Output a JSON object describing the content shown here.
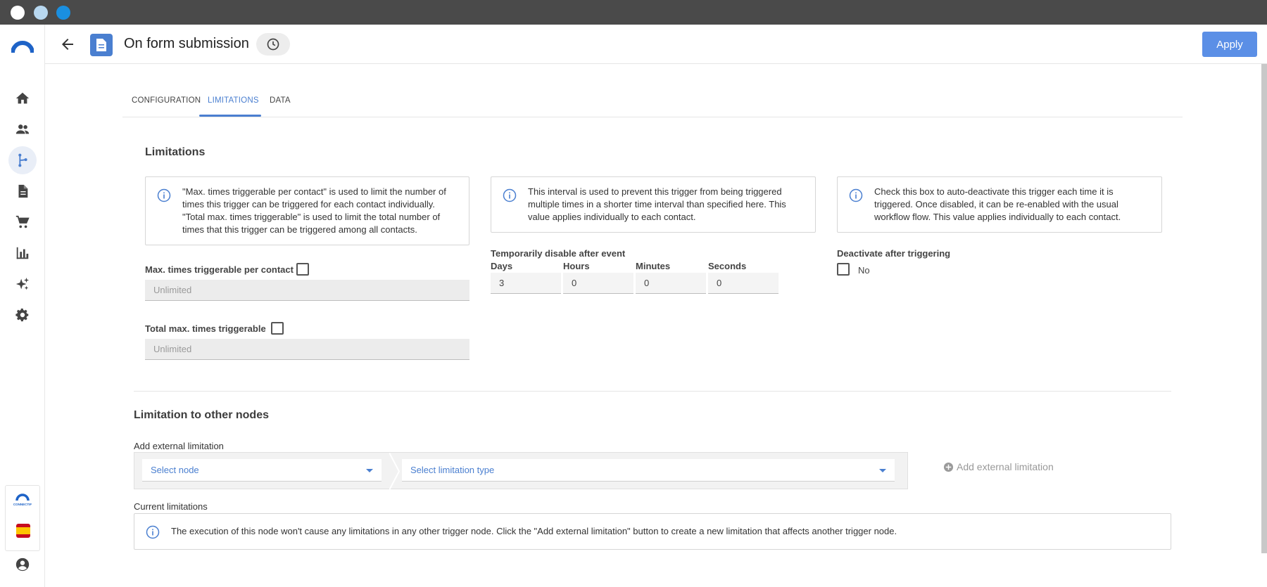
{
  "header": {
    "title": "On form submission",
    "apply_label": "Apply"
  },
  "sidebar": {
    "items": [
      {
        "icon": "home-icon"
      },
      {
        "icon": "contacts-icon"
      },
      {
        "icon": "workflow-icon",
        "active": true
      },
      {
        "icon": "document-icon"
      },
      {
        "icon": "cart-icon"
      },
      {
        "icon": "analytics-icon"
      },
      {
        "icon": "sparkle-icon"
      },
      {
        "icon": "settings-icon"
      }
    ],
    "brand_small": "CONNECTIF"
  },
  "tabs": [
    {
      "label": "CONFIGURATION"
    },
    {
      "label": "LIMITATIONS",
      "active": true
    },
    {
      "label": "DATA"
    }
  ],
  "limitations": {
    "title": "Limitations",
    "info1": [
      "\"Max. times triggerable per contact\" is used to limit the number of",
      "times this trigger can be triggered for each contact individually.",
      "\"Total max. times triggerable\" is used to limit the total number of",
      "times that this trigger can be triggered among all contacts."
    ],
    "info2": [
      "This interval is used to prevent this trigger from being triggered",
      "multiple times in a shorter time interval than specified here. This",
      "value applies individually to each contact."
    ],
    "info3": [
      "Check this box to auto-deactivate this trigger each time it is",
      "triggered. Once disabled, it can be re-enabled with the usual",
      "workflow flow. This value applies individually to each contact."
    ],
    "per_contact_label": "Max. times triggerable per contact",
    "per_contact_value": "Unlimited",
    "total_label": "Total max. times triggerable",
    "total_value": "Unlimited",
    "disable_label": "Temporarily disable after event",
    "days_label": "Days",
    "days_value": "3",
    "hours_label": "Hours",
    "hours_value": "0",
    "minutes_label": "Minutes",
    "minutes_value": "0",
    "seconds_label": "Seconds",
    "seconds_value": "0",
    "deactivate_label": "Deactivate after triggering",
    "deactivate_value": "No"
  },
  "other_nodes": {
    "title": "Limitation to other nodes",
    "add_label": "Add external limitation",
    "select_node": "Select node",
    "select_type": "Select limitation type",
    "add_button": "Add external limitation",
    "current_label": "Current limitations",
    "current_info": "The execution of this node won't cause any limitations in any other trigger node. Click the \"Add external limitation\" button to create a new limitation that affects another trigger node."
  },
  "colors": {
    "accent": "#4a7fd0",
    "apply": "#5b8fe6"
  }
}
